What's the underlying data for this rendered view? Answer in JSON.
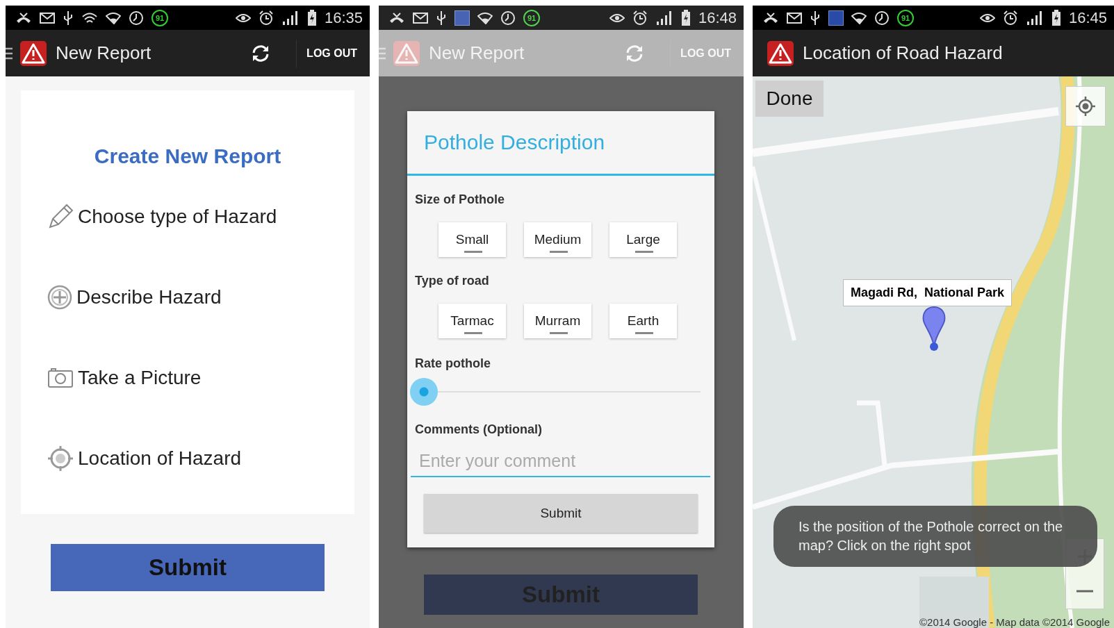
{
  "screens": [
    {
      "kind": "report",
      "status_bar": {
        "badge": "91",
        "weather": false,
        "time": "16:35"
      },
      "app_bar": {
        "title": "New Report",
        "action": "LOG OUT",
        "menu": true,
        "refresh": true
      },
      "card": {
        "heading": "Create New Report",
        "items": [
          {
            "label": "Choose type of Hazard"
          },
          {
            "label": "Describe Hazard"
          },
          {
            "label": "Take a Picture"
          },
          {
            "label": "Location of Hazard"
          }
        ]
      },
      "submit": "Submit"
    },
    {
      "kind": "dialog",
      "dimmed": true,
      "status_bar": {
        "badge": "91",
        "weather": true,
        "time": "16:48"
      },
      "app_bar": {
        "title": "New Report",
        "action": "LOG OUT",
        "menu": true,
        "refresh": true
      },
      "dialog": {
        "title": "Pothole Description",
        "groups": [
          {
            "label": "Size of Pothole",
            "options": [
              {
                "label": "Small",
                "selected": false
              },
              {
                "label": "Medium",
                "selected": false
              },
              {
                "label": "Large",
                "selected": false
              }
            ]
          },
          {
            "label": "Type of road",
            "options": [
              {
                "label": "Tarmac",
                "selected": false
              },
              {
                "label": "Murram",
                "selected": false
              },
              {
                "label": "Earth",
                "selected": false
              }
            ]
          }
        ],
        "rating": {
          "label": "Rate pothole",
          "level": 0
        },
        "comments": {
          "label": "Comments (Optional)",
          "placeholder": "Enter your comment"
        },
        "submit": "Submit"
      },
      "submit": "Submit"
    },
    {
      "kind": "map",
      "status_bar": {
        "badge": "91",
        "weather": true,
        "time": "16:45"
      },
      "app_bar": {
        "title": "Location of Road Hazard"
      },
      "map": {
        "kind": "picture",
        "done": "Done",
        "marker_label": "Magadi Rd,  National Park",
        "toast": "Is the position of the Pothole correct on the map? Click on the right spot",
        "attribution": "©2014 Google - Map data ©2014 Google"
      }
    }
  ]
}
